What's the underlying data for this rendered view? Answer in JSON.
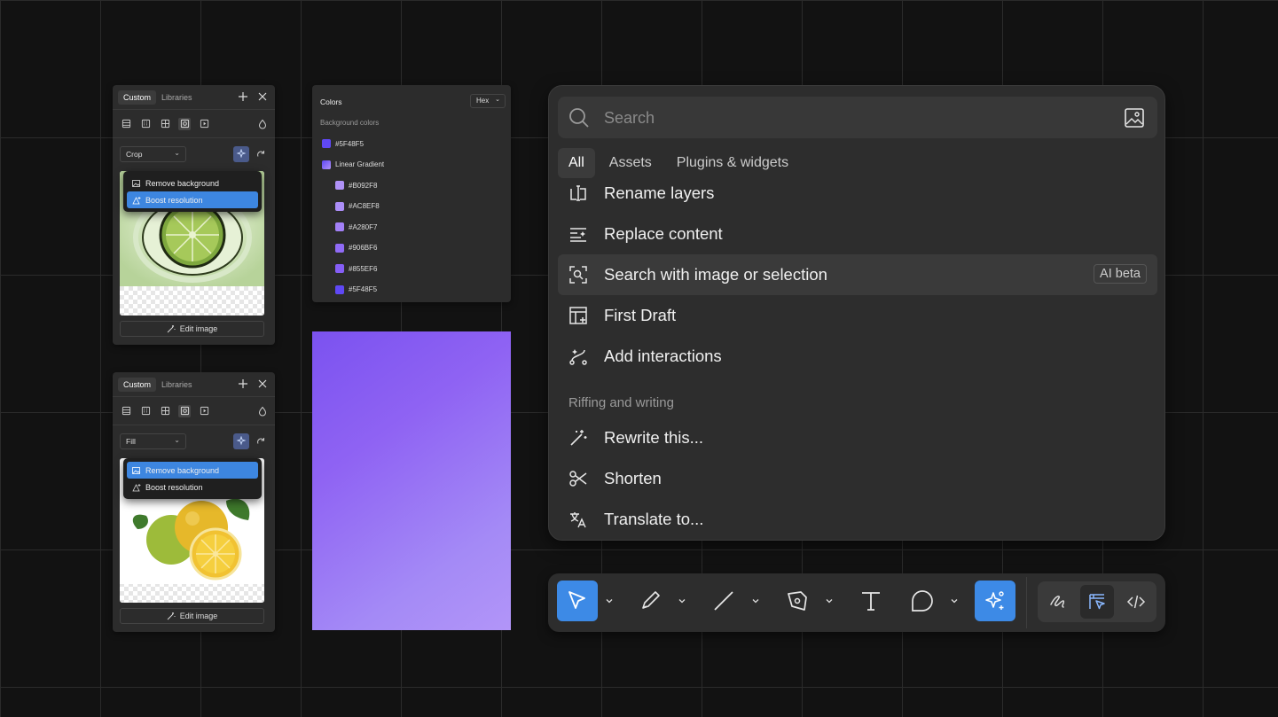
{
  "image_panels": [
    {
      "tabs": [
        "Custom",
        "Libraries"
      ],
      "scale_mode": "Crop",
      "menu_items": [
        "Remove background",
        "Boost resolution"
      ],
      "highlighted_item": "Boost resolution",
      "edit_label": "Edit image"
    },
    {
      "tabs": [
        "Custom",
        "Libraries"
      ],
      "scale_mode": "Fill",
      "menu_items": [
        "Remove background",
        "Boost resolution"
      ],
      "highlighted_item": "Remove background",
      "edit_label": "Edit image"
    }
  ],
  "colors_panel": {
    "title": "Colors",
    "format": "Hex",
    "subtitle": "Background colors",
    "items": [
      {
        "label": "#5F48F5",
        "color": "#5F48F5",
        "indent": false
      },
      {
        "label": "Linear Gradient",
        "color": "#8E6BF5",
        "indent": false
      },
      {
        "label": "#B092F8",
        "color": "#B092F8",
        "indent": true
      },
      {
        "label": "#AC8EF8",
        "color": "#AC8EF8",
        "indent": true
      },
      {
        "label": "#A280F7",
        "color": "#A280F7",
        "indent": true
      },
      {
        "label": "#906BF6",
        "color": "#906BF6",
        "indent": true
      },
      {
        "label": "#855EF6",
        "color": "#855EF6",
        "indent": true
      },
      {
        "label": "#5F48F5",
        "color": "#5F48F5",
        "indent": true
      }
    ]
  },
  "quick_actions": {
    "search_placeholder": "Search",
    "tabs": [
      "All",
      "Assets",
      "Plugins & widgets"
    ],
    "active_tab": "All",
    "items": [
      {
        "label": "Rename layers",
        "icon": "rename-icon"
      },
      {
        "label": "Replace content",
        "icon": "replace-content-icon"
      },
      {
        "label": "Search with image or selection",
        "icon": "image-search-icon",
        "badge": "AI beta"
      },
      {
        "label": "First Draft",
        "icon": "first-draft-icon"
      },
      {
        "label": "Add interactions",
        "icon": "interactions-icon"
      }
    ],
    "section_title": "Riffing and writing",
    "section_items": [
      {
        "label": "Rewrite this...",
        "icon": "magic-wand-icon"
      },
      {
        "label": "Shorten",
        "icon": "scissors-icon"
      },
      {
        "label": "Translate to...",
        "icon": "translate-icon"
      }
    ]
  },
  "toolbar": {
    "tools": [
      "move-tool",
      "brush-tool",
      "line-tool",
      "pen-tool",
      "text-tool",
      "comment-tool",
      "ai-tool"
    ],
    "active_tool": "move-tool",
    "modes": [
      "draw-mode",
      "design-mode",
      "dev-mode"
    ],
    "active_mode": "design-mode"
  },
  "colors": {
    "accent": "#3D8AE6",
    "canvas": "#121212",
    "panel": "#2C2C2C"
  }
}
